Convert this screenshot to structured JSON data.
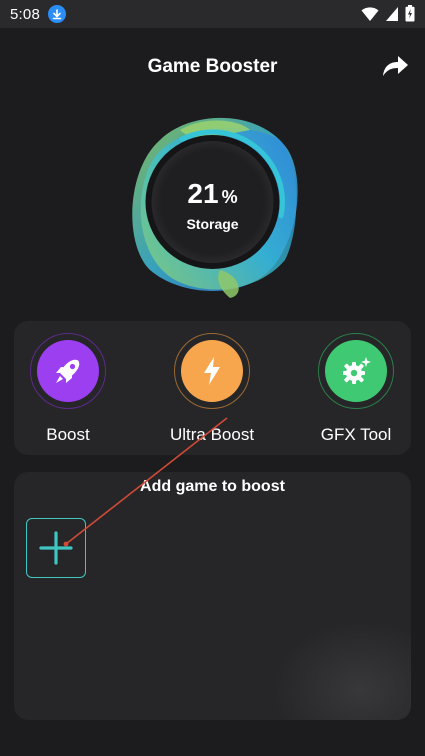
{
  "status_bar": {
    "time": "5:08",
    "icons": [
      "download-icon",
      "wifi-icon",
      "signal-icon",
      "battery-icon"
    ]
  },
  "header": {
    "title": "Game Booster",
    "share_icon": "share-icon"
  },
  "gauge": {
    "value": "21",
    "unit": "%",
    "label": "Storage",
    "fraction": 0.21
  },
  "actions": [
    {
      "label": "Boost",
      "icon": "rocket-icon",
      "color": "#9b3ff0"
    },
    {
      "label": "Ultra Boost",
      "icon": "lightning-icon",
      "color": "#f7a64e"
    },
    {
      "label": "GFX Tool",
      "icon": "gear-sparkle-icon",
      "color": "#3fc972"
    }
  ],
  "games": {
    "title": "Add game to boost",
    "add_icon": "plus-icon"
  },
  "colors": {
    "background": "#1c1c1e",
    "card": "#262628",
    "accent_teal": "#3fc6c0",
    "pointer": "#d04a36"
  }
}
